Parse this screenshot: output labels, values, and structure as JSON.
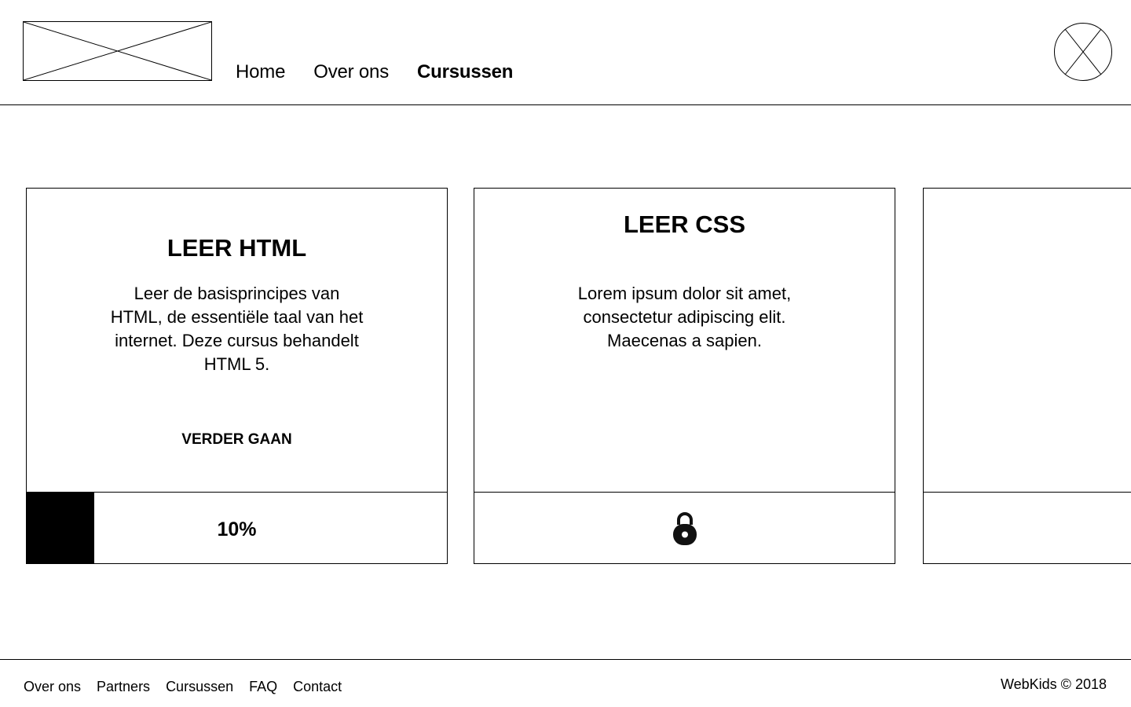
{
  "header": {
    "nav": [
      {
        "label": "Home",
        "active": false
      },
      {
        "label": "Over ons",
        "active": false
      },
      {
        "label": "Cursussen",
        "active": true
      }
    ]
  },
  "courses": [
    {
      "title": "LEER HTML",
      "description": "Leer de basisprincipes van HTML, de essentiële taal van het internet. Deze cursus behandelt HTML 5.",
      "action_label": "VERDER GAAN",
      "progress": {
        "value": 0.1,
        "label": "10%"
      },
      "locked": false
    },
    {
      "title": "LEER CSS",
      "description": "Lorem ipsum dolor sit amet, consectetur adipiscing elit. Maecenas a sapien.",
      "locked": true,
      "status_icon": "lock-icon"
    },
    {
      "title": "",
      "description": ""
    }
  ],
  "footer": {
    "links": [
      "Over ons",
      "Partners",
      "Cursussen",
      "FAQ",
      "Contact"
    ],
    "copyright": "WebKids © 2018"
  }
}
